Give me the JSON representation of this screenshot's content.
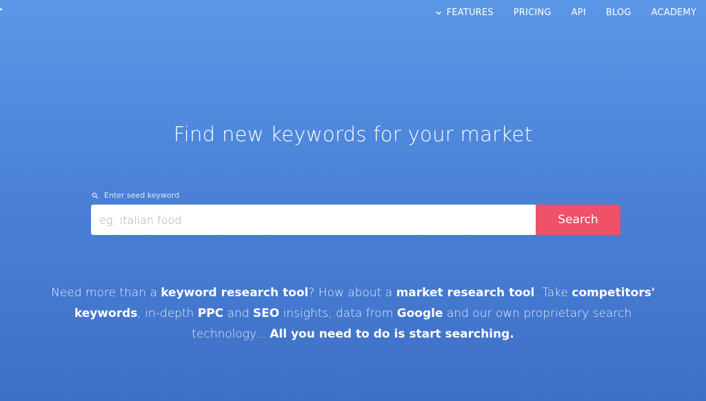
{
  "nav": {
    "items": [
      {
        "label": "FEATURES"
      },
      {
        "label": "PRICING"
      },
      {
        "label": "API"
      },
      {
        "label": "BLOG"
      },
      {
        "label": "ACADEMY"
      }
    ]
  },
  "hero": {
    "title": "Find new keywords for your market"
  },
  "search": {
    "label": "Enter seed keyword",
    "placeholder": "eg, italian food",
    "value": "",
    "button_label": "Search"
  },
  "description": {
    "t1": "Need more than a ",
    "b1": "keyword research tool",
    "t2": "? How about a ",
    "b2": "market research tool",
    "t3": ". Take ",
    "b3": "competitors' keywords",
    "t4": ", in-depth ",
    "b4": "PPC",
    "t5": " and ",
    "b5": "SEO",
    "t6": " insights, data from ",
    "b6": "Google",
    "t7": " and our own proprietary search technology... ",
    "b7": "All you need to do is start searching."
  },
  "colors": {
    "background_top": "#5b97e6",
    "background_bottom": "#3e6fc6",
    "search_button": "#ee5168"
  },
  "icons": {
    "features_chevron": "chevron-down-icon",
    "search_label": "search-icon"
  }
}
